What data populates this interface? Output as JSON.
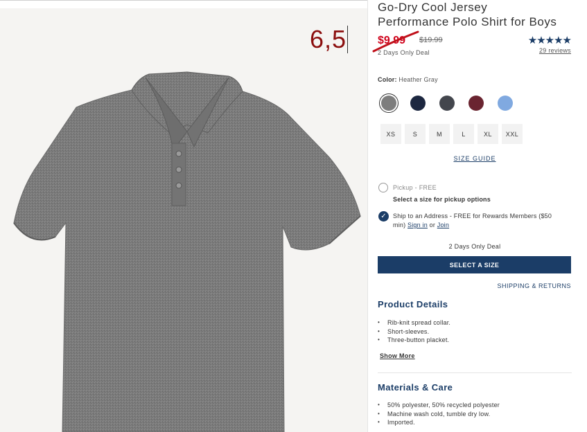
{
  "annotation": {
    "text": "6,5"
  },
  "product": {
    "title_line1": "Go-Dry Cool Jersey",
    "title_line2": "Performance Polo Shirt for Boys",
    "sale_price": "$9.99",
    "original_price": "$19.99",
    "deal_label": "2 Days Only Deal",
    "rating_stars": 5,
    "reviews_text": "29 reviews"
  },
  "color": {
    "label": "Color:",
    "selected": "Heather Gray",
    "swatches": [
      {
        "name": "heather-gray",
        "hex": "#7d7d7d",
        "selected": true
      },
      {
        "name": "navy",
        "hex": "#1c2740",
        "selected": false
      },
      {
        "name": "charcoal",
        "hex": "#43464d",
        "selected": false
      },
      {
        "name": "burgundy",
        "hex": "#6a2430",
        "selected": false
      },
      {
        "name": "light-blue",
        "hex": "#80a9e0",
        "selected": false
      }
    ]
  },
  "sizes": [
    "XS",
    "S",
    "M",
    "L",
    "XL",
    "XXL"
  ],
  "size_guide": "SIZE GUIDE",
  "fulfillment": {
    "pickup_label": "Pickup - FREE",
    "pickup_note": "Select a size for pickup options",
    "ship_text_1": "Ship to an Address - FREE for Rewards Members ($50",
    "ship_text_2": "min)",
    "sign_in": "Sign in",
    "or_text": "or",
    "join": "Join"
  },
  "deal_mid": "2 Days Only Deal",
  "select_button": "SELECT A SIZE",
  "shipping_returns": "SHIPPING & RETURNS",
  "product_details": {
    "title": "Product Details",
    "items": [
      "Rib-knit spread collar.",
      "Short-sleeves.",
      "Three-button placket."
    ],
    "show_more": "Show More"
  },
  "materials": {
    "title": "Materials & Care",
    "items": [
      "50% polyester, 50% recycled polyester",
      "Machine wash cold, tumble dry low.",
      "Imported."
    ]
  },
  "colors": {
    "accent": "#1b3d67",
    "sale": "#d0021b",
    "annotation": "#8b0e0e"
  }
}
